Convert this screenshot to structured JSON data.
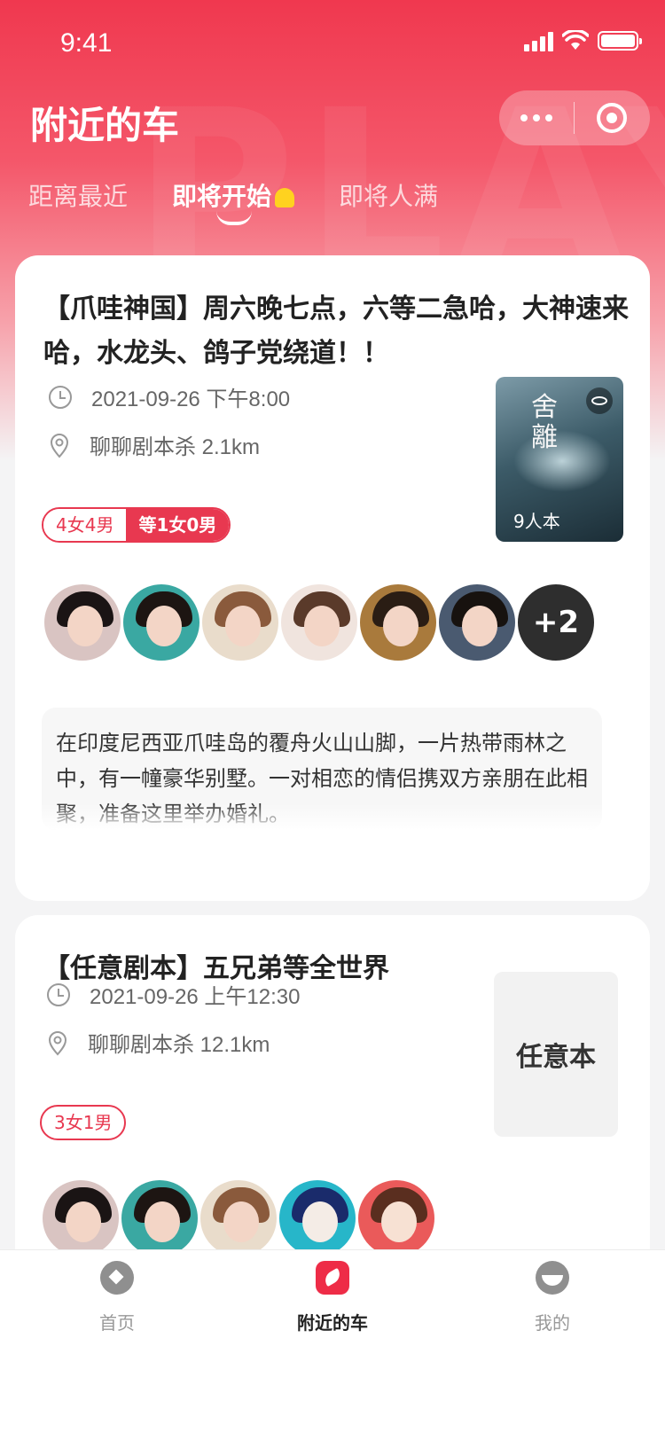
{
  "status_bar": {
    "time": "9:41"
  },
  "header": {
    "title": "附近的车",
    "watermark": "PLAY",
    "tabs": [
      {
        "label": "距离最近",
        "active": false
      },
      {
        "label": "即将开始",
        "active": true
      },
      {
        "label": "即将人满",
        "active": false
      }
    ]
  },
  "cards": [
    {
      "title": "【爪哇神国】周六晚七点，六等二急哈，大神速来哈，水龙头、鸽子党绕道！！",
      "datetime": "2021-09-26   下午8:00",
      "location": "聊聊剧本杀 2.1km",
      "tags": {
        "composition": "4女4男",
        "waiting": "等1女0男"
      },
      "cover": {
        "players_label": "9人本",
        "title_glyph": "舍\n離"
      },
      "avatars_more": "+2",
      "description": "在印度尼西亚爪哇岛的覆舟火山山脚，一片热带雨林之中，有一幢豪华别墅。一对相恋的情侣携双方亲朋在此相聚，准备这里举办婚礼。"
    },
    {
      "title": "【任意剧本】五兄弟等全世界",
      "datetime": "2021-09-26   上午12:30",
      "location": "聊聊剧本杀 12.1km",
      "tags": {
        "composition": "3女1男"
      },
      "cover": {
        "text": "任意本"
      }
    }
  ],
  "tabbar": {
    "items": [
      {
        "label": "首页",
        "icon": "home-icon"
      },
      {
        "label": "附近的车",
        "icon": "car-icon",
        "active": true
      },
      {
        "label": "我的",
        "icon": "profile-icon"
      }
    ]
  },
  "colors": {
    "brand": "#ee2c47",
    "tag": "#e83850"
  }
}
